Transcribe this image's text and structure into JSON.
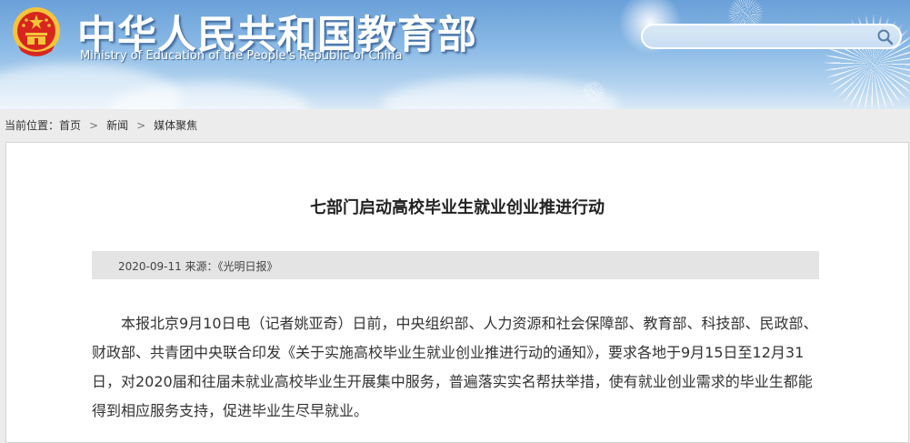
{
  "site": {
    "title_cn": "中华人民共和国教育部",
    "title_en": "Ministry of Education of the People's Republic of China"
  },
  "search": {
    "value": "",
    "placeholder": ""
  },
  "breadcrumb": {
    "prefix": "当前位置：",
    "items": [
      "首页",
      "新闻",
      "媒体聚焦"
    ]
  },
  "article": {
    "title": "七部门启动高校毕业生就业创业推进行动",
    "meta": "2020-09-11  来源：《光明日报》",
    "body_lines": [
      "本报北京9月10日电（记者姚亚奇）日前，中央组织部、人力资源和社会保障部、教育部、科技部、民政部、",
      "财政部、共青团中央联合印发《关于实施高校毕业生就业创业推进行动的通知》，要求各地于9月15日至12月31",
      "日，对2020届和往届未就业高校毕业生开展集中服务，普遍落实实名帮扶举措，使有就业创业需求的毕业生都能",
      "得到相应服务支持，促进毕业生尽早就业。"
    ]
  },
  "colors": {
    "header_sky": "#8cbbe6",
    "emblem_red": "#d7261e",
    "emblem_gold": "#f4c43a",
    "meta_bar": "#e4e4e4"
  },
  "icons": {
    "emblem": "national-emblem-icon",
    "search": "search-icon"
  }
}
